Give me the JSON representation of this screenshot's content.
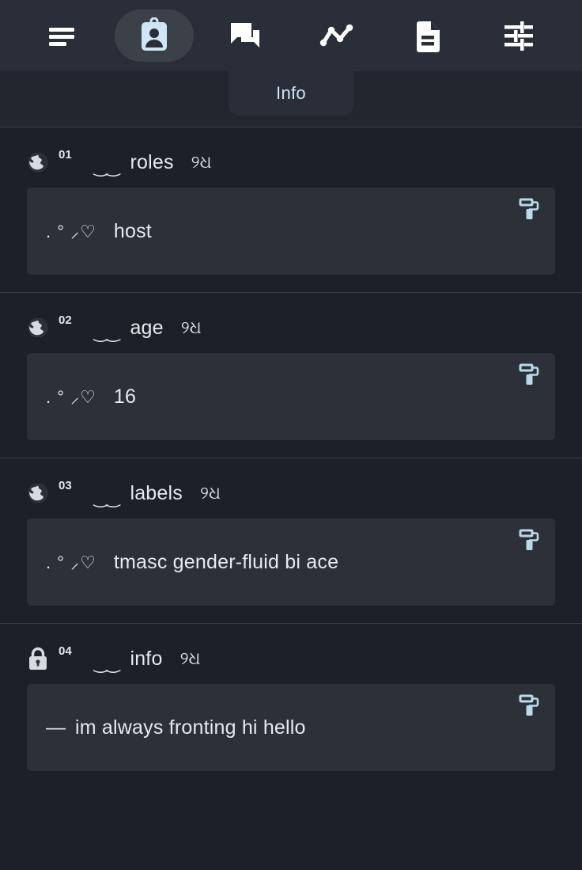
{
  "nav": {
    "items": [
      {
        "icon": "menu-icon",
        "name": "menu",
        "label": "Menu",
        "active": false
      },
      {
        "icon": "badge-id-icon",
        "name": "info",
        "label": "Info",
        "active": true
      },
      {
        "icon": "chat-bubbles-icon",
        "name": "chat",
        "label": "Chat",
        "active": false
      },
      {
        "icon": "line-chart-icon",
        "name": "stats",
        "label": "Stats",
        "active": false
      },
      {
        "icon": "document-icon",
        "name": "notes",
        "label": "Notes",
        "active": false
      },
      {
        "icon": "tune-sliders-icon",
        "name": "settings",
        "label": "Settings",
        "active": false
      }
    ]
  },
  "tooltip": {
    "label": "Info",
    "color": "#cfe7f5"
  },
  "theme": {
    "background": "#1c2028",
    "topbar": "#2a2e38",
    "card": "#2b3039",
    "accent": "#cfe7f5",
    "divider": "#3a3f49",
    "text": "#e6eaef"
  },
  "entries": [
    {
      "index": "01",
      "visibility": "globe-icon",
      "visibility_label": "public",
      "deco_left": "‿‿",
      "title": "roles",
      "deco_right": "୨ଧ",
      "value_deco": ". ° ⸝♡",
      "value_prefix": "",
      "value": "host",
      "action": "paint-roller-icon"
    },
    {
      "index": "02",
      "visibility": "globe-icon",
      "visibility_label": "public",
      "deco_left": "‿‿",
      "title": "age",
      "deco_right": "୨ଧ",
      "value_deco": ". ° ⸝♡",
      "value_prefix": "",
      "value": "16",
      "action": "paint-roller-icon"
    },
    {
      "index": "03",
      "visibility": "globe-icon",
      "visibility_label": "public",
      "deco_left": "‿‿",
      "title": "labels",
      "deco_right": "୨ଧ",
      "value_deco": ". ° ⸝♡",
      "value_prefix": "",
      "value": "tmasc gender-fluid bi ace",
      "action": "paint-roller-icon"
    },
    {
      "index": "04",
      "visibility": "lock-icon",
      "visibility_label": "private",
      "deco_left": "‿‿",
      "title": "info",
      "deco_right": "୨ଧ",
      "value_deco": "",
      "value_prefix": "—",
      "value": "im always fronting hi hello",
      "action": "paint-roller-icon"
    }
  ]
}
